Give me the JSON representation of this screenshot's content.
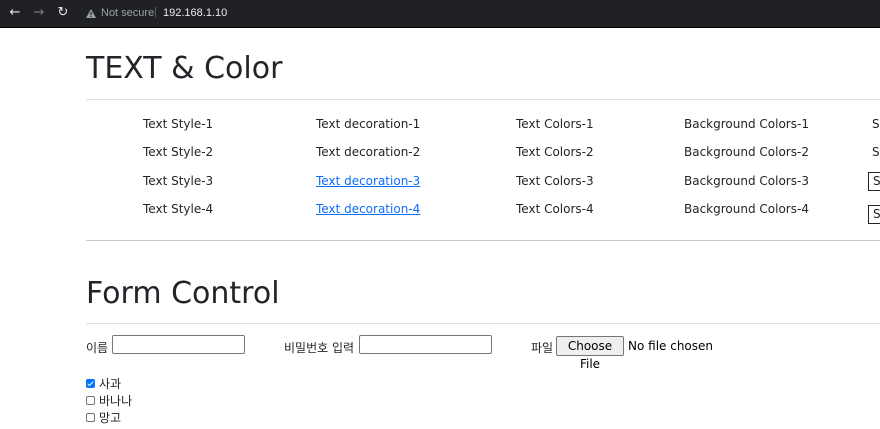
{
  "browser": {
    "security_label": "Not secure",
    "separator": "|",
    "url": "192.168.1.10",
    "back_icon": "←",
    "forward_icon": "→",
    "reload_icon": "↻"
  },
  "text_color_section": {
    "title": "TEXT & Color",
    "rows": [
      {
        "style": "Text Style-1",
        "decoration": "Text decoration-1",
        "colors": "Text Colors-1",
        "background": "Background Colors-1",
        "span": "Sp"
      },
      {
        "style": "Text Style-2",
        "decoration": "Text decoration-2",
        "colors": "Text Colors-2",
        "background": "Background Colors-2",
        "span": "Sp"
      },
      {
        "style": "Text Style-3",
        "decoration": "Text decoration-3",
        "colors": "Text Colors-3",
        "background": "Background Colors-3",
        "span": "S"
      },
      {
        "style": "Text Style-4",
        "decoration": "Text decoration-4",
        "colors": "Text Colors-4",
        "background": "Background Colors-4",
        "span": "S"
      }
    ]
  },
  "form_section": {
    "title": "Form Control",
    "name_label": "이름",
    "name_value": "",
    "password_label": "비밀번호 입력",
    "password_value": "",
    "file_label": "파일",
    "file_button": "Choose File",
    "file_status": "No file chosen",
    "checkboxes": [
      {
        "label": "사과",
        "checked": true
      },
      {
        "label": "바나나",
        "checked": false
      },
      {
        "label": "망고",
        "checked": false
      }
    ]
  },
  "colors": {
    "link": "#0d6efd",
    "checkbox_accent": "#0075ff",
    "topbar": "#202124"
  }
}
